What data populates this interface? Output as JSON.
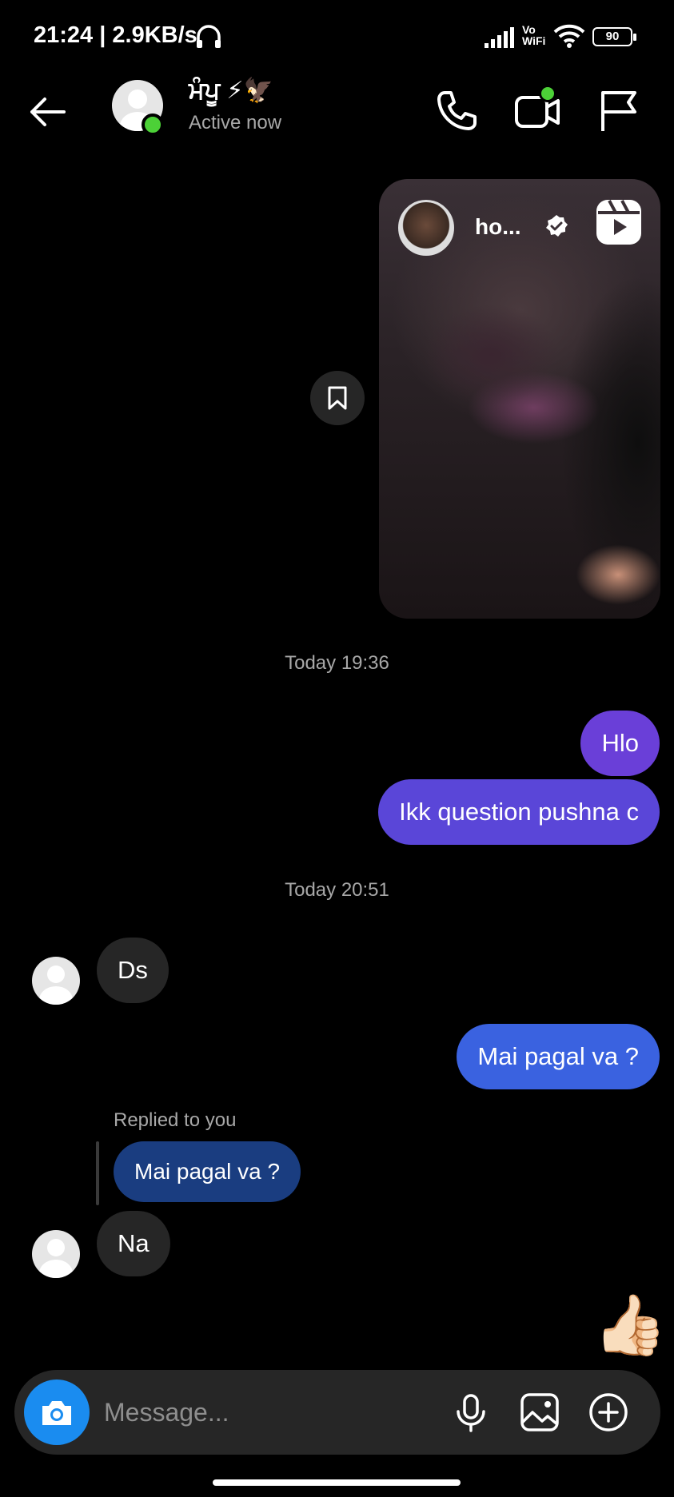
{
  "status_bar": {
    "time": "21:24 | 2.9KB/s",
    "vowifi_line1": "Vo",
    "vowifi_line2": "WiFi",
    "battery": "90"
  },
  "header": {
    "contact_name": "ਮੰਪੂ ⚡🦅",
    "contact_status": "Active now",
    "online": true
  },
  "reel": {
    "username": "ho...",
    "verified": true
  },
  "messages": {
    "timestamp_1": "Today 19:36",
    "out_1": "Hlo",
    "out_2": "Ikk question pushna c",
    "timestamp_2": "Today 20:51",
    "in_1": "Ds",
    "out_3": "Mai pagal va ?",
    "replied_label": "Replied to you",
    "reply_quote": "Mai pagal va ?",
    "in_2": "Na",
    "reaction_emoji": "👍🏻"
  },
  "composer": {
    "placeholder": "Message..."
  },
  "colors": {
    "background": "#000000",
    "online_green": "#4cd137",
    "camera_blue": "#1a8cf0",
    "outgoing_purple": "#6a3fd8",
    "outgoing_blue": "#3a62e0",
    "incoming_gray": "#262626"
  }
}
